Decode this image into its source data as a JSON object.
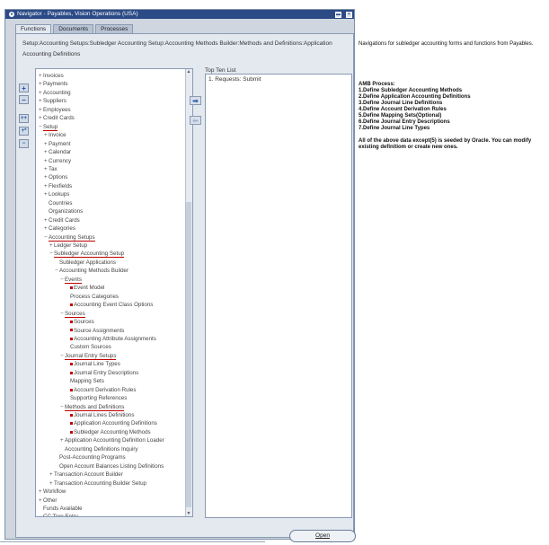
{
  "window": {
    "title": "Navigator - Payables, Vision Operations (USA)"
  },
  "tabs": [
    "Functions",
    "Documents",
    "Processes"
  ],
  "breadcrumb": "Setup:Accounting Setups:Subledger Accounting Setup:Accounting Methods Builder:Methods and Definitions:Application Accounting Definitions",
  "tree": [
    {
      "t": "Invoices",
      "d": 0,
      "e": "+"
    },
    {
      "t": "Payments",
      "d": 0,
      "e": "+"
    },
    {
      "t": "Accounting",
      "d": 0,
      "e": "+"
    },
    {
      "t": "Suppliers",
      "d": 0,
      "e": "+"
    },
    {
      "t": "Employees",
      "d": 0,
      "e": "+"
    },
    {
      "t": "Credit Cards",
      "d": 0,
      "e": "+"
    },
    {
      "t": "Setup",
      "d": 0,
      "e": "-",
      "u": true
    },
    {
      "t": "Invoice",
      "d": 1,
      "e": "+"
    },
    {
      "t": "Payment",
      "d": 1,
      "e": "+"
    },
    {
      "t": "Calendar",
      "d": 1,
      "e": "+"
    },
    {
      "t": "Currency",
      "d": 1,
      "e": "+"
    },
    {
      "t": "Tax",
      "d": 1,
      "e": "+"
    },
    {
      "t": "Options",
      "d": 1,
      "e": "+"
    },
    {
      "t": "Flexfields",
      "d": 1,
      "e": "+"
    },
    {
      "t": "Lookups",
      "d": 1,
      "e": "+"
    },
    {
      "t": "Countries",
      "d": 1,
      "e": ""
    },
    {
      "t": "Organizations",
      "d": 1,
      "e": ""
    },
    {
      "t": "Credit Cards",
      "d": 1,
      "e": "+"
    },
    {
      "t": "Categories",
      "d": 1,
      "e": "+"
    },
    {
      "t": "Accounting Setups",
      "d": 1,
      "e": "-",
      "u": true
    },
    {
      "t": "Ledger Setup",
      "d": 2,
      "e": "+"
    },
    {
      "t": "Subledger Accounting Setup",
      "d": 2,
      "e": "-",
      "u": true
    },
    {
      "t": "Subledger Applications",
      "d": 3,
      "e": ""
    },
    {
      "t": "Accounting Methods Builder",
      "d": 3,
      "e": "-"
    },
    {
      "t": "Events",
      "d": 4,
      "e": "-",
      "u": true
    },
    {
      "t": "Event Model",
      "d": 5,
      "e": "",
      "b": true
    },
    {
      "t": "Process Categories",
      "d": 5,
      "e": ""
    },
    {
      "t": "Accounting Event Class Options",
      "d": 5,
      "e": "",
      "b": true
    },
    {
      "t": "Sources",
      "d": 4,
      "e": "-",
      "u": true
    },
    {
      "t": "Sources",
      "d": 5,
      "e": "",
      "b": true
    },
    {
      "t": "Source Assignments",
      "d": 5,
      "e": "",
      "b": true
    },
    {
      "t": "Accounting Attribute Assignments",
      "d": 5,
      "e": "",
      "b": true
    },
    {
      "t": "Custom Sources",
      "d": 5,
      "e": ""
    },
    {
      "t": "Journal Entry Setups",
      "d": 4,
      "e": "-",
      "u": true
    },
    {
      "t": "Journal Line Types",
      "d": 5,
      "e": "",
      "b": true
    },
    {
      "t": "Journal Entry Descriptions",
      "d": 5,
      "e": "",
      "b": true
    },
    {
      "t": "Mapping Sets",
      "d": 5,
      "e": ""
    },
    {
      "t": "Account Derivation Rules",
      "d": 5,
      "e": "",
      "b": true
    },
    {
      "t": "Supporting References",
      "d": 5,
      "e": ""
    },
    {
      "t": "Methods and Definitions",
      "d": 4,
      "e": "-",
      "u": true
    },
    {
      "t": "Journal Lines Definitions",
      "d": 5,
      "e": "",
      "b": true
    },
    {
      "t": "Application Accounting Definitions",
      "d": 5,
      "e": "",
      "b": true
    },
    {
      "t": "Subledger Accounting Methods",
      "d": 5,
      "e": "",
      "b": true
    },
    {
      "t": "Application Accounting Definition Loader",
      "d": 4,
      "e": "+"
    },
    {
      "t": "Accounting Definitions Inquiry",
      "d": 4,
      "e": ""
    },
    {
      "t": "Post-Accounting Programs",
      "d": 3,
      "e": ""
    },
    {
      "t": "Open Account Balances Listing Definitions",
      "d": 3,
      "e": ""
    },
    {
      "t": "Transaction Account Builder",
      "d": 2,
      "e": "+"
    },
    {
      "t": "Transaction Accounting Builder Setup",
      "d": 2,
      "e": "+"
    },
    {
      "t": "Workflow",
      "d": 0,
      "e": "+"
    },
    {
      "t": "Other",
      "d": 0,
      "e": "+"
    },
    {
      "t": "Funds Available",
      "d": 0,
      "e": ""
    },
    {
      "t": "CC Trxn Entry",
      "d": 0,
      "e": ""
    }
  ],
  "top_ten": {
    "label": "Top Ten List",
    "items": [
      "1. Requests: Submit"
    ]
  },
  "buttons": {
    "open": "Open"
  },
  "notes": {
    "intro": "Navigations for subledger accounting forms and functions from Payables.",
    "amo_title": "AMB Process:",
    "amo_steps": [
      "1.Define Subledger Accounting Methods",
      "2.Define Application Accounting Definitions",
      "3.Define Journal Line Definitions",
      "4.Define Account Derivation Rules",
      "5.Define Mapping Sets(Optional)",
      "6.Define Journal Entry Descriptions",
      "7.Define Journal Line Types"
    ],
    "seed_note": "All of the above data except(5) is seeded by Oracle. You can modify existing definitiom or create new ones."
  }
}
